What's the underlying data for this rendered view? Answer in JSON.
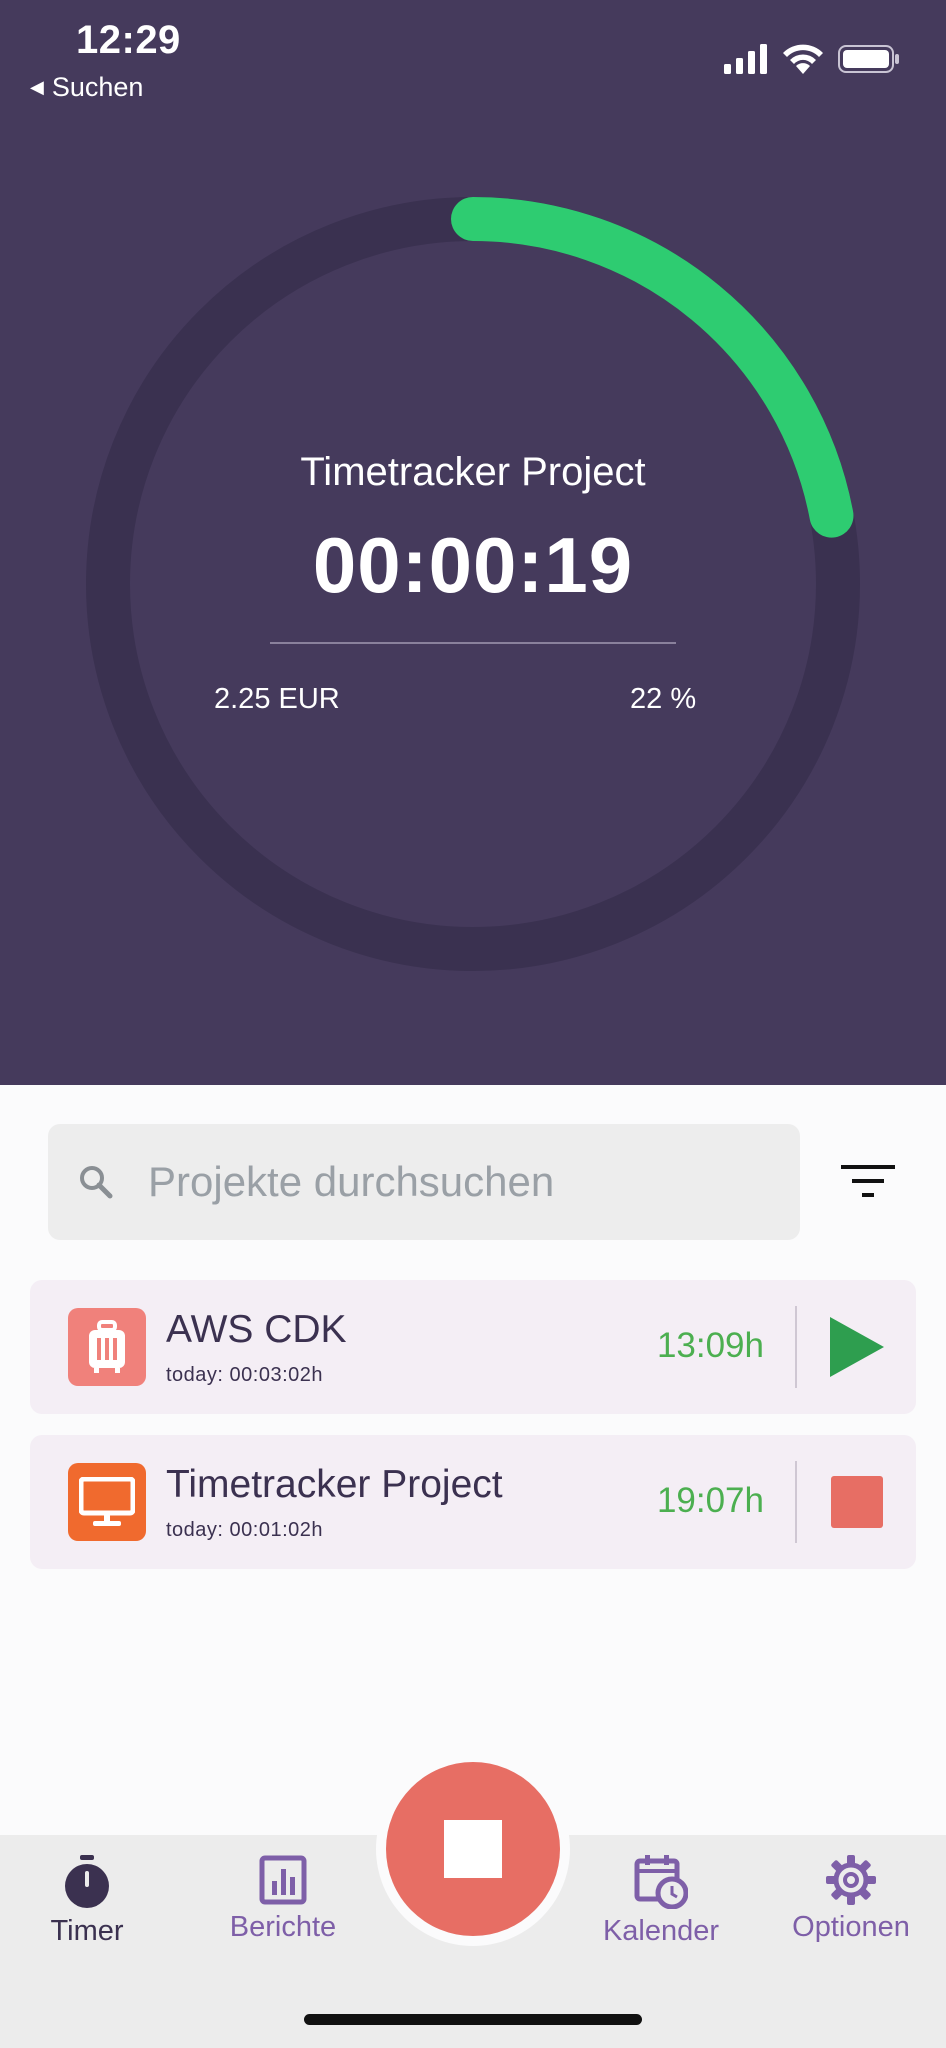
{
  "status_bar": {
    "time": "12:29",
    "back_label": "Suchen"
  },
  "timer": {
    "project": "Timetracker Project",
    "elapsed": "00:00:19",
    "earnings": "2.25 EUR",
    "percent_label": "22 %",
    "progress": 0.22
  },
  "search": {
    "placeholder": "Projekte durchsuchen"
  },
  "projects": [
    {
      "name": "AWS CDK",
      "today": "today: 00:03:02h",
      "total": "13:09h",
      "icon": "suitcase-icon",
      "icon_color": "#f0817b",
      "action": "play",
      "action_color": "#2e9e4f"
    },
    {
      "name": "Timetracker Project",
      "today": "today: 00:01:02h",
      "total": "19:07h",
      "icon": "monitor-icon",
      "icon_color": "#f06a2e",
      "action": "stop",
      "action_color": "#e76e64"
    }
  ],
  "tabs": [
    {
      "label": "Timer",
      "icon": "stopwatch-icon",
      "active": true
    },
    {
      "label": "Berichte",
      "icon": "bar-chart-icon",
      "active": false
    },
    {
      "label": "Kalender",
      "icon": "calendar-clock-icon",
      "active": false
    },
    {
      "label": "Optionen",
      "icon": "gear-icon",
      "active": false
    }
  ],
  "colors": {
    "header_bg": "#453a5c",
    "ring_track": "#3a3150",
    "ring_progress": "#2ecc71",
    "fab": "#e76e64",
    "accent": "#7e5fa8"
  }
}
